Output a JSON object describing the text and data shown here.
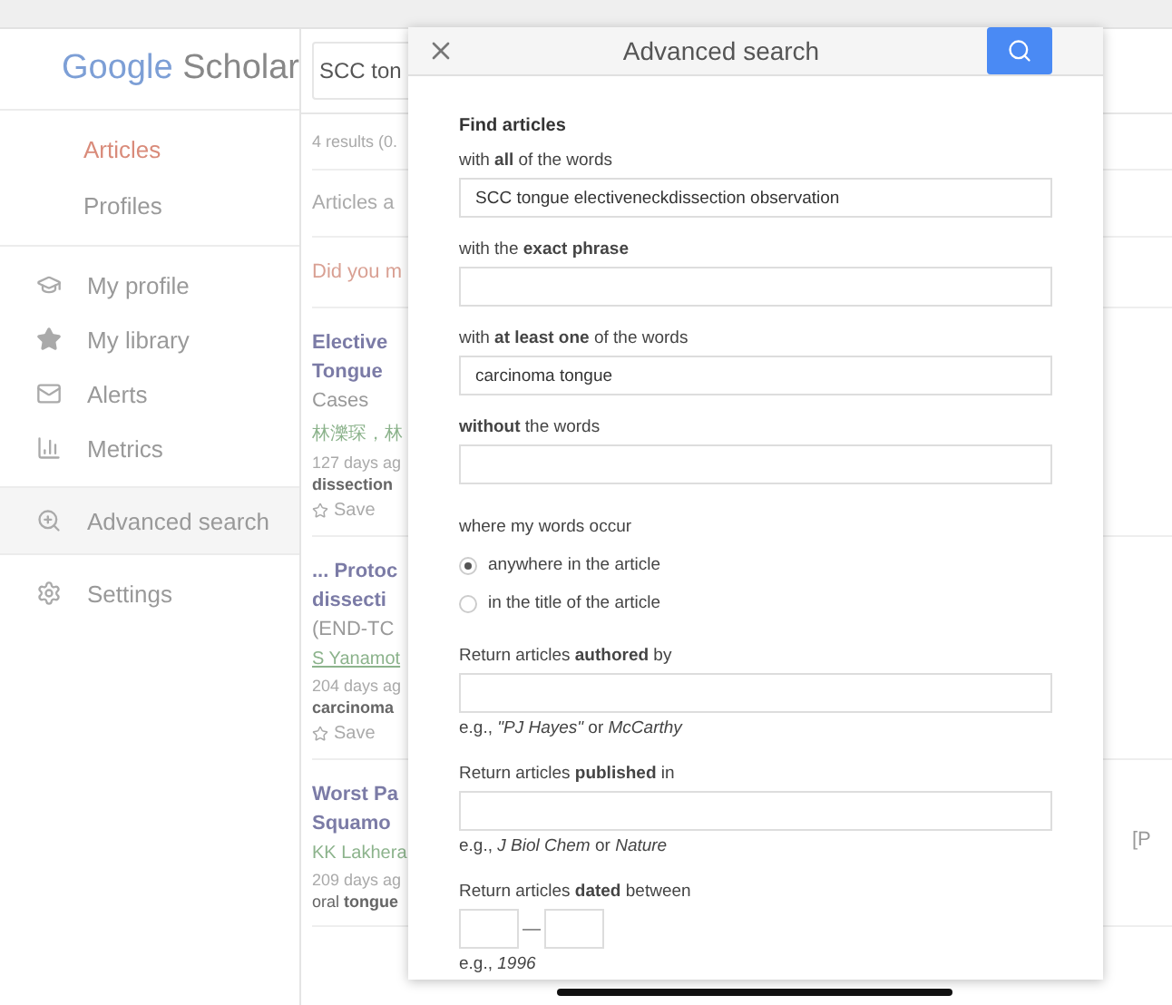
{
  "sidebar": {
    "logo": {
      "google": "Google",
      "scholar": "Scholar"
    },
    "nav": [
      {
        "label": "Articles",
        "selected": true
      },
      {
        "label": "Profiles",
        "selected": false
      }
    ],
    "menu": [
      {
        "label": "My profile",
        "selected": false
      },
      {
        "label": "My library",
        "selected": false
      },
      {
        "label": "Alerts",
        "selected": false
      },
      {
        "label": "Metrics",
        "selected": false
      },
      {
        "label": "Advanced search",
        "selected": true
      },
      {
        "label": "Settings",
        "selected": false
      }
    ]
  },
  "results": {
    "search_value": "SCC ton",
    "count": "4 results (0.",
    "heading": "Articles a",
    "suggestion": "Did you m",
    "items": [
      {
        "title": [
          "Elective",
          "Tongue"
        ],
        "subtitle": "Cases",
        "authors": "林濼琛，林",
        "authors_link": false,
        "meta": "127 days ag",
        "snippet": "**dissection**",
        "save": "Save"
      },
      {
        "title": [
          "... Protoc",
          "dissecti"
        ],
        "subtitle": "(END-TC",
        "authors": "S Yanamot",
        "authors_link": true,
        "meta": "204 days ag",
        "snippet": "**carcinoma**",
        "save": "Save"
      },
      {
        "title": [
          "Worst Pa",
          "Squamo"
        ],
        "authors": "KK Lakhera",
        "authors_link": false,
        "meta": "209 days ag",
        "snippet": "oral **tongue**"
      }
    ]
  },
  "right_edge": "[P",
  "modal": {
    "title": "Advanced search",
    "section_title": "Find articles",
    "fields": [
      {
        "label": "with **all** of the words",
        "value": "SCC tongue electiveneckdissection observation"
      },
      {
        "label": "with the **exact phrase**"
      },
      {
        "label": "with **at least one** of the words",
        "value": "carcinoma tongue"
      },
      {
        "label": "**without** the words"
      }
    ],
    "occur": {
      "label": "where my words occur",
      "options": [
        {
          "label": "anywhere in the article",
          "selected": true
        },
        {
          "label": "in the title of the article",
          "selected": false
        }
      ]
    },
    "return_fields": [
      {
        "label": "Return articles **authored** by",
        "hint": "e.g., *\"PJ Hayes\"* or *McCarthy*"
      },
      {
        "label": "Return articles **published** in",
        "hint": "e.g., *J Biol Chem* or *Nature*"
      }
    ],
    "date": {
      "label": "Return articles **dated** between",
      "separator": "—",
      "hint": "e.g., *1996*"
    }
  }
}
